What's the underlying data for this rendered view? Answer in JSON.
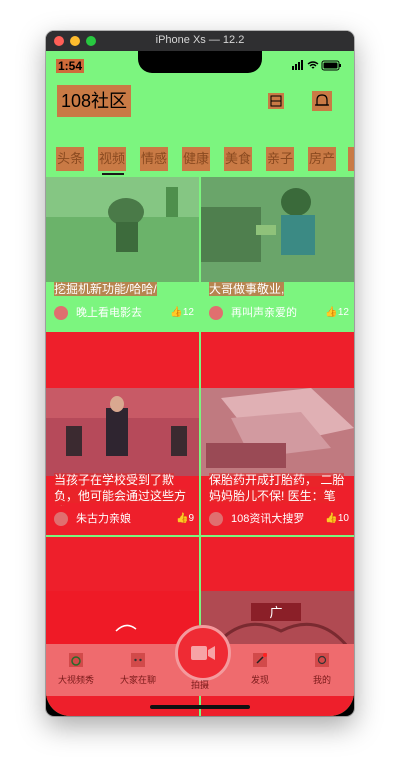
{
  "window": {
    "title": "iPhone Xs — 12.2"
  },
  "status_bar": {
    "time": "1:54"
  },
  "header": {
    "logo": "108社区"
  },
  "tabs": [
    "头条",
    "视频",
    "情感",
    "健康",
    "美食",
    "亲子",
    "房产"
  ],
  "active_tab": "视频",
  "cards": [
    {
      "title": "挖掘机新功能/哈哈/",
      "author": "晚上看电影去",
      "likes": "12"
    },
    {
      "title": "大哥做事敬业,",
      "author": "再叫声亲爱的",
      "likes": "12"
    },
    {
      "title": "当孩子在学校受到了欺负，他可能会通过这些方式",
      "author": "朱古力亲娘",
      "likes": "9"
    },
    {
      "title": "保胎药开成打胎药， 二胎妈妈胎儿不保! 医生：笔",
      "author": "108资讯大搜罗",
      "likes": "10"
    }
  ],
  "tabbar": {
    "items": [
      "大视频秀",
      "大家在聊",
      "",
      "发现",
      "我的"
    ],
    "center_label": "拍摄"
  },
  "colors": {
    "screen_bg": "#7cf57f",
    "card_red": "#ee1f2b",
    "tag": "#c97a45"
  }
}
